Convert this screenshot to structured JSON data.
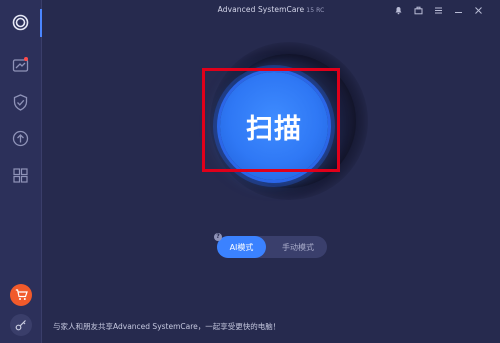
{
  "window": {
    "title": "Advanced SystemCare",
    "version": "15 RC"
  },
  "sidebar": {
    "items": [
      {
        "name": "care",
        "icon": "ring-icon",
        "active": true
      },
      {
        "name": "speedup",
        "icon": "speedometer-icon",
        "has_notification": true
      },
      {
        "name": "protect",
        "icon": "shield-check-icon"
      },
      {
        "name": "update",
        "icon": "arrow-up-circle-icon"
      },
      {
        "name": "toolbox",
        "icon": "grid-icon"
      }
    ],
    "bottom": [
      {
        "name": "shop",
        "icon": "cart-icon"
      },
      {
        "name": "license",
        "icon": "key-icon"
      }
    ]
  },
  "main": {
    "scan_button_label": "扫描",
    "modes": {
      "ai_label": "AI模式",
      "manual_label": "手动模式",
      "selected": "ai",
      "help_glyph": "?"
    },
    "footer_text": "与家人和朋友共享Advanced SystemCare，一起享受更快的电脑！"
  },
  "colors": {
    "background": "#262a4e",
    "sidebar": "#2c305a",
    "accent_blue": "#3b82ff",
    "highlight_red": "#e0001a",
    "cart_orange": "#f15a2b"
  }
}
